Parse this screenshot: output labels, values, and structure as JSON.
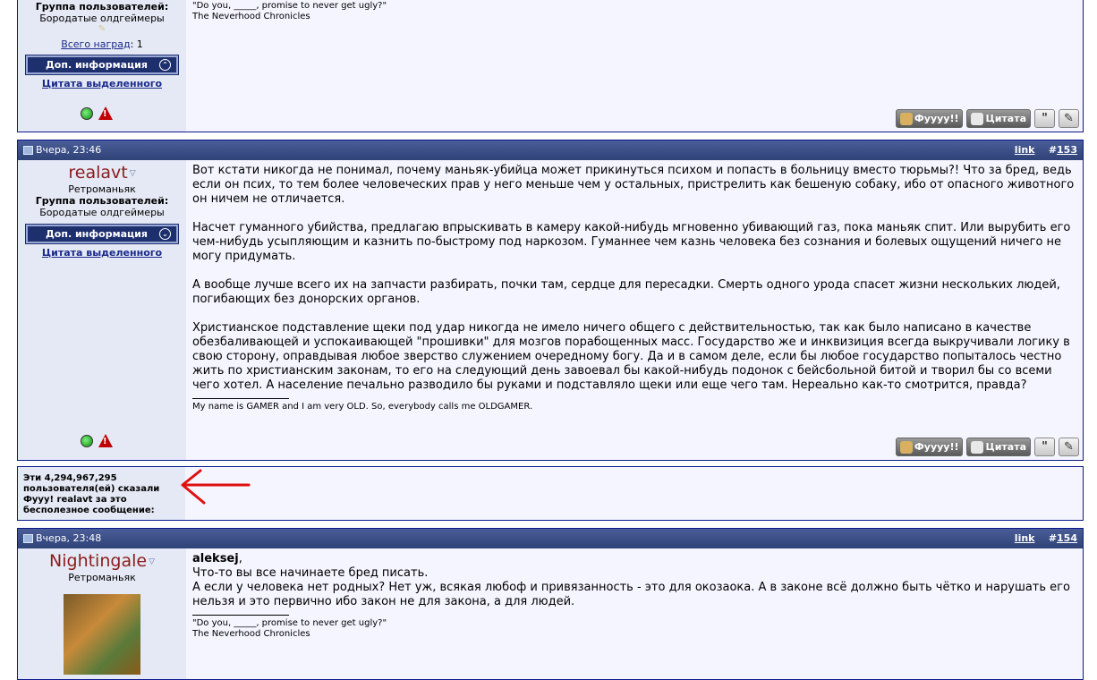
{
  "post_top": {
    "user_group_label": "Группа пользователей:",
    "user_group": "Бородатые олдгеймеры",
    "awards_link": "Всего наград",
    "awards_count": ": 1",
    "addinfo_label": "Доп. информация",
    "quote_selected": "Цитата выделенного",
    "sig_line1": "\"Do you, _____, promise to never get ugly?\"",
    "sig_line2": "The Neverhood Chronicles"
  },
  "post_153": {
    "date": "Вчера, 23:46",
    "link_label": "link",
    "num_prefix": "#",
    "num": "153",
    "username": "realavt",
    "user_title": "Ретроманьяк",
    "user_group_label": "Группа пользователей:",
    "user_group": "Бородатые олдгеймеры",
    "addinfo_label": "Доп. информация",
    "quote_selected": "Цитата выделенного",
    "p1": "Вот кстати никогда не понимал, почему маньяк-убийца может прикинуться психом и попасть в больницу вместо тюрьмы?! Что за бред, ведь если он псих, то тем более человеческих прав у него меньше чем у остальных, пристрелить как бешеную собаку, ибо от опасного животного он ничем не отличается.",
    "p2": "Насчет гуманного убийства, предлагаю впрыскивать в камеру какой-нибудь мгновенно убивающий газ, пока маньяк спит. Или вырубить его чем-нибудь усыпляющим и казнить по-быстрому под наркозом. Гуманнее чем казнь человека без сознания и болевых ощущений ничего не могу придумать.",
    "p3": "А вообще лучше всего их на запчасти разбирать, почки там, сердце для пересадки. Смерть одного урода спасет жизни нескольких людей, погибающих без донорских органов.",
    "p4": "Христианское подставление щеки под удар никогда не имело ничего общего с действительностью, так как было написано в качестве обезбаливающей и успокаивающей \"прошивки\" для мозгов порабощенных масс. Государство же и инквизиция всегда выкручивали логику в свою сторону, оправдывая любое зверство служением очередному богу. Да и в самом деле, если бы любое государство попыталось честно жить по христианским законам, то его на следующий день завоевал бы какой-нибудь подонок с бейсбольной битой и творил бы со всеми чего хотел. А население печально разводило бы руками и подставляло щеки или еще чего там. Нереально как-то смотрится, правда?",
    "signature": "My name is GAMER and I am very OLD. So, everybody calls me OLDGAMER."
  },
  "buttons": {
    "fuuu": "Фуууу!!",
    "quote": "Цитата",
    "multiquote": "\"",
    "edit": "✎"
  },
  "thanks": {
    "text": "Эти 4,294,967,295 пользователя(ей) сказали Фууу! realavt за это бесполезное сообщение:"
  },
  "post_154": {
    "date": "Вчера, 23:48",
    "link_label": "link",
    "num_prefix": "#",
    "num": "154",
    "username": "Nightingale",
    "user_title": "Ретроманьяк",
    "reply_to": "aleksej",
    "reply_comma": ",",
    "line1": "Что-то вы все начинаете бред писать.",
    "line2": "А если у человека нет родных? Нет уж, всякая любоф и привязанность - это для окозаока. А в законе всё должно быть чётко и нарушать его нельзя и это первично ибо закон не для закона, а для людей.",
    "sig_line1": "\"Do you, _____, promise to never get ugly?\"",
    "sig_line2": "The Neverhood Chronicles"
  },
  "colors": {
    "header_bg": "#3a4d84",
    "user_col_bg": "#e5e9f5",
    "username": "#8b1c1c",
    "arrow": "#e01010"
  }
}
